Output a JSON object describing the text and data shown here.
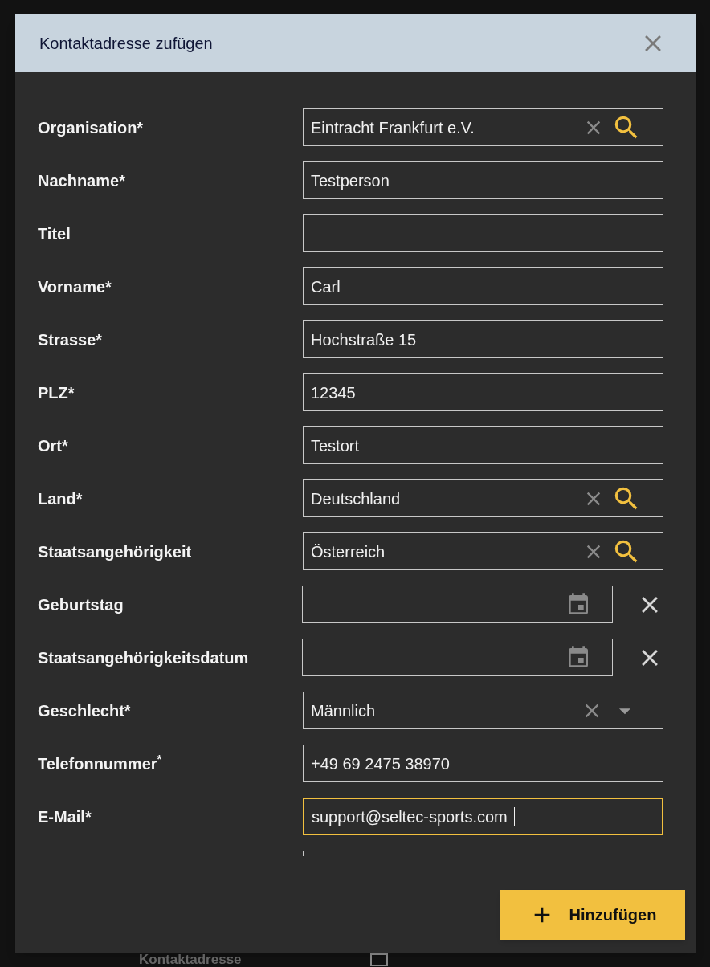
{
  "dialog": {
    "title": "Kontaktadresse zufügen"
  },
  "fields": [
    {
      "label": "Organisation*",
      "kind": "lookup",
      "value": "Eintracht Frankfurt e.V.",
      "focused": false
    },
    {
      "label": "Nachname*",
      "kind": "text",
      "value": "Testperson",
      "focused": false
    },
    {
      "label": "Titel",
      "kind": "text",
      "focused": false
    },
    {
      "label": "Vorname*",
      "kind": "text",
      "value": "Carl",
      "focused": false
    },
    {
      "label": "Strasse*",
      "kind": "text",
      "value": "Hochstraße 15",
      "focused": false
    },
    {
      "label": "PLZ*",
      "kind": "text",
      "value": "12345",
      "focused": false
    },
    {
      "label": "Ort*",
      "kind": "text",
      "value": "Testort",
      "focused": false
    },
    {
      "label": "Land*",
      "kind": "lookup",
      "value": "Deutschland",
      "focused": false
    },
    {
      "label": "Staatsangehörigkeit",
      "kind": "lookup",
      "value": "Österreich",
      "focused": false
    },
    {
      "label": "Geburtstag",
      "kind": "date",
      "focused": false
    },
    {
      "label": "Staatsangehörigkeitsdatum",
      "kind": "date",
      "focused": false
    },
    {
      "label": "Geschlecht*",
      "kind": "select",
      "value": "Männlich",
      "focused": false
    },
    {
      "label": "Telefonnummer$^{*}$",
      "kind": "text",
      "value": "+49 69 2475 38970",
      "focused": false
    },
    {
      "label": "E-Mail*",
      "kind": "text",
      "value": "support@seltec-sports.com",
      "focused": true
    }
  ],
  "add_button": {
    "label": "Hinzufügen"
  },
  "background": {
    "label": "Kontaktadresse",
    "checkbox": {
      "checked": false
    }
  }
}
